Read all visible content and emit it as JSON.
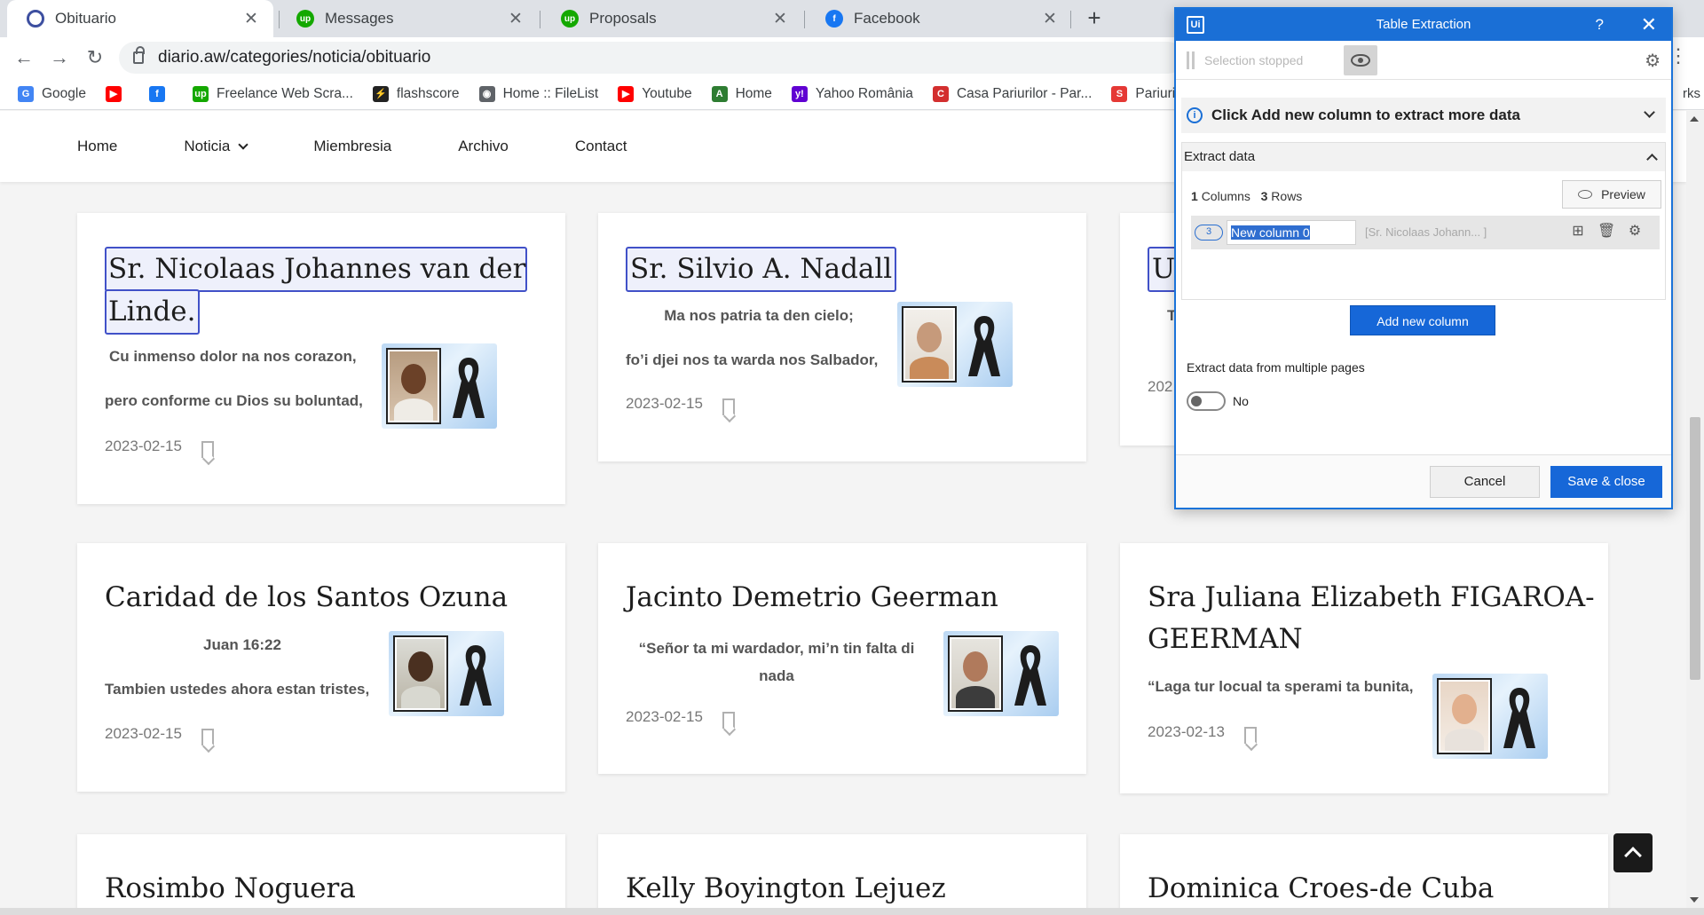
{
  "tabs": [
    {
      "title": "Obituario",
      "icon": "obituario-icon",
      "active": true
    },
    {
      "title": "Messages",
      "icon": "upwork-icon",
      "active": false
    },
    {
      "title": "Proposals",
      "icon": "upwork-icon",
      "active": false
    },
    {
      "title": "Facebook",
      "icon": "facebook-icon",
      "active": false
    }
  ],
  "browser": {
    "url": "diario.aw/categories/noticia/obituario",
    "close_glyph": "✕",
    "newtab_glyph": "+"
  },
  "bookmarks": [
    {
      "label": "Google",
      "icon": "google-icon",
      "color": "#4285f4",
      "glyph": "G"
    },
    {
      "label": "",
      "icon": "youtube-icon",
      "color": "#ff0000",
      "glyph": "▶"
    },
    {
      "label": "",
      "icon": "facebook-icon",
      "color": "#1877f2",
      "glyph": "f"
    },
    {
      "label": "Freelance Web Scra...",
      "icon": "upwork-icon",
      "color": "#14a800",
      "glyph": "up"
    },
    {
      "label": "flashscore",
      "icon": "flashscore-icon",
      "color": "#222222",
      "glyph": "⚡"
    },
    {
      "label": "Home :: FileList",
      "icon": "globe-icon",
      "color": "#5f6368",
      "glyph": "◉"
    },
    {
      "label": "Youtube",
      "icon": "youtube-icon",
      "color": "#ff0000",
      "glyph": "▶"
    },
    {
      "label": "Home",
      "icon": "filelist-icon",
      "color": "#2e7d32",
      "glyph": "A"
    },
    {
      "label": "Yahoo România",
      "icon": "yahoo-icon",
      "color": "#6001d2",
      "glyph": "y!"
    },
    {
      "label": "Casa Pariurilor - Par...",
      "icon": "casa-icon",
      "color": "#d32f2f",
      "glyph": "C"
    },
    {
      "label": "Pariuri sportive",
      "icon": "superbet-icon",
      "color": "#e53935",
      "glyph": "S"
    }
  ],
  "bookmarks_overflow": "rks",
  "site_nav": [
    {
      "label": "Home",
      "dropdown": false
    },
    {
      "label": "Noticia",
      "dropdown": true
    },
    {
      "label": "Miembresia",
      "dropdown": false
    },
    {
      "label": "Archivo",
      "dropdown": false
    },
    {
      "label": "Contact",
      "dropdown": false
    }
  ],
  "cards": [
    {
      "title": "Sr. Nicolaas Johannes van der Linde.",
      "title_line1": "Sr. Nicolaas Johannes van der",
      "title_line2": "Linde.",
      "excerpt_line1": "Cu inmenso dolor na nos corazon,",
      "excerpt_line2": "pero conforme cu Dios su boluntad,",
      "date": "2023-02-15",
      "selected": true
    },
    {
      "title": "Sr. Silvio A. Nadall",
      "excerpt_line1": "Ma nos patria ta den cielo;",
      "excerpt_line2": "fo’i djei nos ta warda nos Salbador,",
      "date": "2023-02-15",
      "selected": true
    },
    {
      "title_visible": "Ur",
      "excerpt_visible": "T",
      "date_visible": "202",
      "selected": true
    },
    {
      "title": "Caridad de los Santos Ozuna",
      "excerpt_line1": "Juan 16:22",
      "excerpt_line2": "Tambien ustedes ahora estan tristes,",
      "date": "2023-02-15"
    },
    {
      "title": "Jacinto Demetrio Geerman",
      "excerpt_line1": "“Señor ta mi wardador, mi’n tin falta di",
      "excerpt_line2": "nada",
      "date": "2023-02-15"
    },
    {
      "title_line1": "Sra Juliana Elizabeth FIGAROA-",
      "title_line2": "GEERMAN",
      "excerpt_line1": "“Laga tur locual ta sperami ta bunita,",
      "date": "2023-02-13"
    },
    {
      "title": "Rosimbo Noguera"
    },
    {
      "title": "Kelly Boyington Lejuez"
    },
    {
      "title": "Dominica Croes-de Cuba"
    }
  ],
  "dialog": {
    "title": "Table Extraction",
    "logo": "Ui",
    "help": "?",
    "close": "✕",
    "selection_status": "Selection stopped",
    "info_text": "Click Add new column to extract more data",
    "section_title": "Extract data",
    "columns_count": "1",
    "columns_label": "Columns",
    "rows_count": "3",
    "rows_label": "Rows",
    "preview_label": "Preview",
    "column": {
      "badge": "3",
      "name": "New column 0",
      "preview": "[Sr. Nicolaas Johann... ]"
    },
    "add_column_label": "Add new column",
    "multi_page_label": "Extract data from multiple pages",
    "multi_page_value": "No",
    "cancel_label": "Cancel",
    "save_label": "Save & close",
    "accent": "#1a6fd6"
  }
}
